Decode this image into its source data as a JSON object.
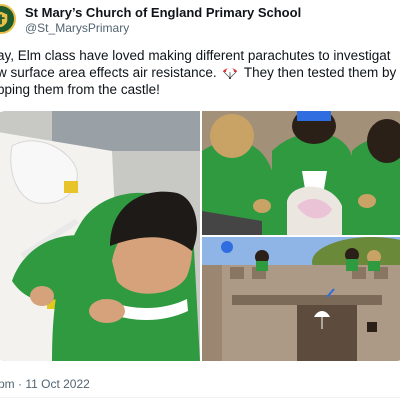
{
  "tweet": {
    "author": {
      "display_name": "St Mary’s Church of England Primary School",
      "handle": "@St_MarysPrimary",
      "avatar_icon": "school-crest-icon"
    },
    "text_lines": [
      "ay, Elm class have loved making different parachutes to investigat",
      "w surface area effects air resistance.",
      " They then tested them by",
      "pping them from the castle!"
    ],
    "emoji": "parachute-icon",
    "timestamp": "pm · 11 Oct 2022"
  },
  "media": {
    "photos": [
      {
        "subject": "child-cutting-paper-photo"
      },
      {
        "subject": "children-making-parachutes-photo"
      },
      {
        "subject": "parachute-drop-castle-photo"
      }
    ]
  },
  "colors": {
    "text": "#0f1419",
    "secondary_text": "#536471",
    "uniform_green": "#2f9a3f",
    "divider": "#eff3f4"
  }
}
